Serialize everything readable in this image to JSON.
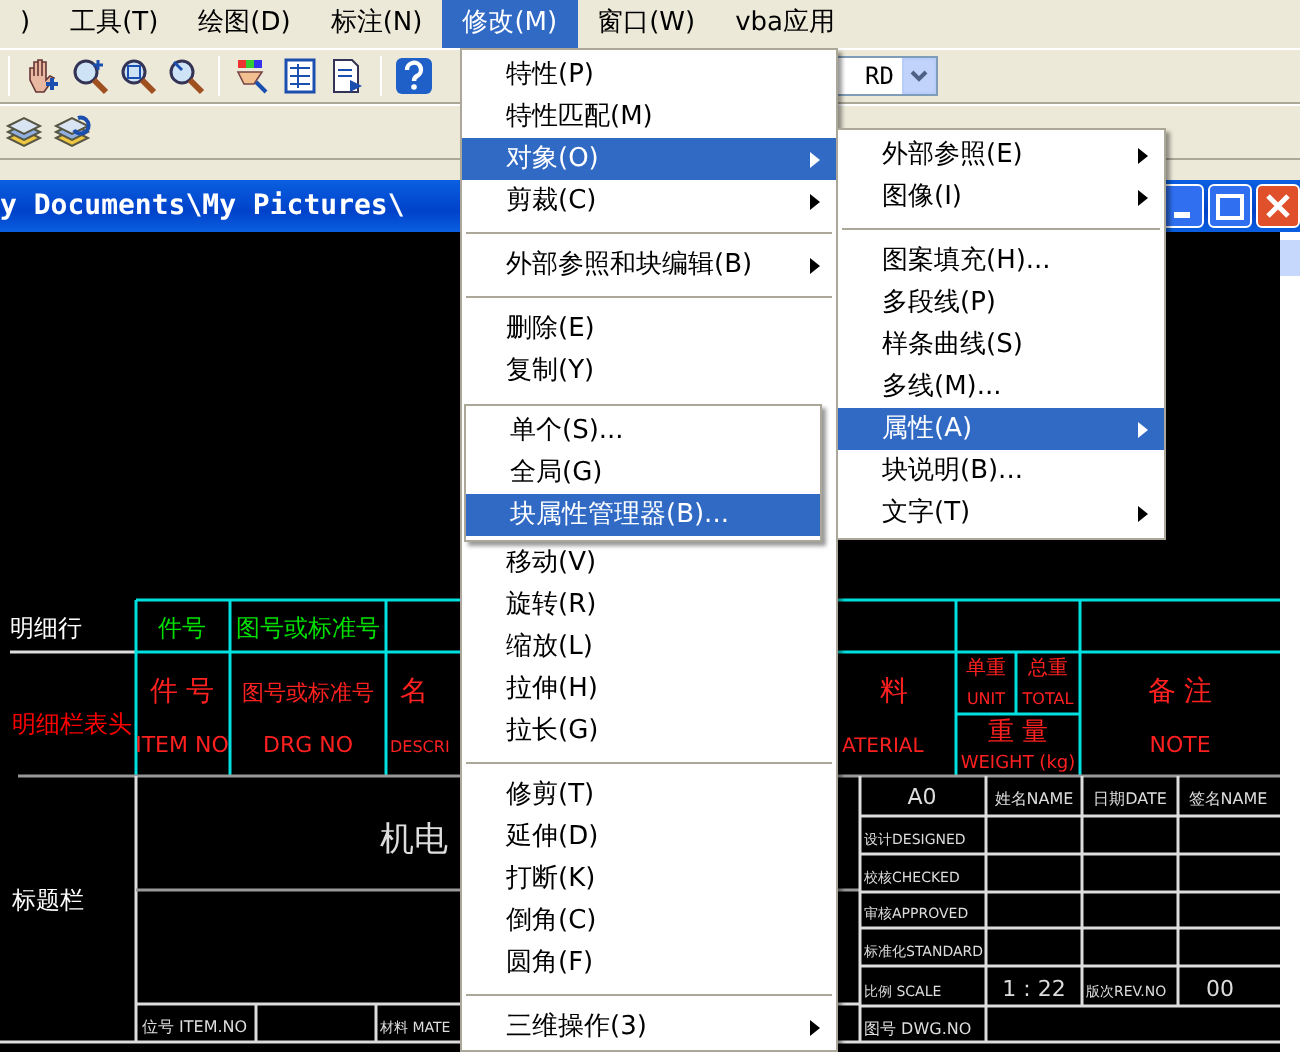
{
  "menubar": [
    {
      "label": ")",
      "selected": false
    },
    {
      "label": "工具(T)",
      "selected": false
    },
    {
      "label": "绘图(D)",
      "selected": false
    },
    {
      "label": "标注(N)",
      "selected": false
    },
    {
      "label": "修改(M)",
      "selected": true
    },
    {
      "label": "窗口(W)",
      "selected": false
    },
    {
      "label": "vba应用",
      "selected": false
    }
  ],
  "toolbar": {
    "combo_value": "RD"
  },
  "document_window": {
    "title": "y Documents\\My Pictures\\"
  },
  "drawing": {
    "row_labels": [
      {
        "text": "明细行",
        "color": "#ffffff"
      },
      {
        "text": "明细栏表头",
        "color": "#ff0000"
      },
      {
        "text": "标题栏",
        "color": "#ffffff"
      }
    ],
    "detail_row": [
      "件号",
      "图号或标准号"
    ],
    "header": [
      {
        "cn": "件 号",
        "en": "ITEM NO"
      },
      {
        "cn": "图号或标准号",
        "en": "DRG NO"
      },
      {
        "cn": "名",
        "en": "DESCRI"
      },
      {
        "cn": "料",
        "en": "ATERIAL"
      },
      {
        "cn": "单重",
        "en": "UNIT"
      },
      {
        "cn": "总重",
        "en": "TOTAL"
      },
      {
        "cn": "重 量",
        "en": "WEIGHT (kg)"
      },
      {
        "cn": "备 注",
        "en": "NOTE"
      }
    ],
    "title_text": "机电",
    "bottom_row": [
      "位号 ITEM.NO",
      "材料 MATE"
    ],
    "signoff_table": {
      "columns": [
        "A0",
        "姓名NAME",
        "日期DATE",
        "签名NAME"
      ],
      "roles": [
        "设计DESIGNED",
        "校核CHECKED",
        "审核APPROVED",
        "标准化STANDARD"
      ],
      "scale_row": [
        "比例 SCALE",
        "1 : 22",
        "版次REV.NO",
        "00"
      ],
      "drawing_no_label": "图号 DWG.NO"
    }
  },
  "modify_menu": {
    "items": [
      {
        "kind": "item",
        "label": "特性(P)",
        "submenu": false,
        "selected": false
      },
      {
        "kind": "item",
        "label": "特性匹配(M)",
        "submenu": false,
        "selected": false
      },
      {
        "kind": "item",
        "label": "对象(O)",
        "submenu": true,
        "selected": true
      },
      {
        "kind": "item",
        "label": "剪裁(C)",
        "submenu": true,
        "selected": false
      },
      {
        "kind": "separator"
      },
      {
        "kind": "item",
        "label": "外部参照和块编辑(B)",
        "submenu": true,
        "selected": false
      },
      {
        "kind": "separator"
      },
      {
        "kind": "item",
        "label": "删除(E)",
        "submenu": false,
        "selected": false
      },
      {
        "kind": "item",
        "label": "复制(Y)",
        "submenu": false,
        "selected": false
      },
      {
        "kind": "item",
        "label": "移动(V)",
        "submenu": false,
        "selected": false
      },
      {
        "kind": "item",
        "label": "旋转(R)",
        "submenu": false,
        "selected": false
      },
      {
        "kind": "item",
        "label": "缩放(L)",
        "submenu": false,
        "selected": false
      },
      {
        "kind": "item",
        "label": "拉伸(H)",
        "submenu": false,
        "selected": false
      },
      {
        "kind": "item",
        "label": "拉长(G)",
        "submenu": false,
        "selected": false
      },
      {
        "kind": "separator"
      },
      {
        "kind": "item",
        "label": "修剪(T)",
        "submenu": false,
        "selected": false
      },
      {
        "kind": "item",
        "label": "延伸(D)",
        "submenu": false,
        "selected": false
      },
      {
        "kind": "item",
        "label": "打断(K)",
        "submenu": false,
        "selected": false
      },
      {
        "kind": "item",
        "label": "倒角(C)",
        "submenu": false,
        "selected": false
      },
      {
        "kind": "item",
        "label": "圆角(F)",
        "submenu": false,
        "selected": false
      },
      {
        "kind": "separator"
      },
      {
        "kind": "item",
        "label": "三维操作(3)",
        "submenu": true,
        "selected": false
      }
    ]
  },
  "object_submenu": {
    "items": [
      {
        "kind": "item",
        "label": "外部参照(E)",
        "submenu": true,
        "selected": false
      },
      {
        "kind": "item",
        "label": "图像(I)",
        "submenu": true,
        "selected": false
      },
      {
        "kind": "separator"
      },
      {
        "kind": "item",
        "label": "图案填充(H)...",
        "submenu": false,
        "selected": false
      },
      {
        "kind": "item",
        "label": "多段线(P)",
        "submenu": false,
        "selected": false
      },
      {
        "kind": "item",
        "label": "样条曲线(S)",
        "submenu": false,
        "selected": false
      },
      {
        "kind": "item",
        "label": "多线(M)...",
        "submenu": false,
        "selected": false
      },
      {
        "kind": "item",
        "label": "属性(A)",
        "submenu": true,
        "selected": true
      },
      {
        "kind": "item",
        "label": "块说明(B)...",
        "submenu": false,
        "selected": false
      },
      {
        "kind": "item",
        "label": "文字(T)",
        "submenu": true,
        "selected": false
      }
    ]
  },
  "attribute_submenu": {
    "items": [
      {
        "kind": "item",
        "label": "单个(S)...",
        "submenu": false,
        "selected": false
      },
      {
        "kind": "item",
        "label": "全局(G)",
        "submenu": false,
        "selected": false
      },
      {
        "kind": "item",
        "label": "块属性管理器(B)...",
        "submenu": false,
        "selected": true
      }
    ]
  }
}
